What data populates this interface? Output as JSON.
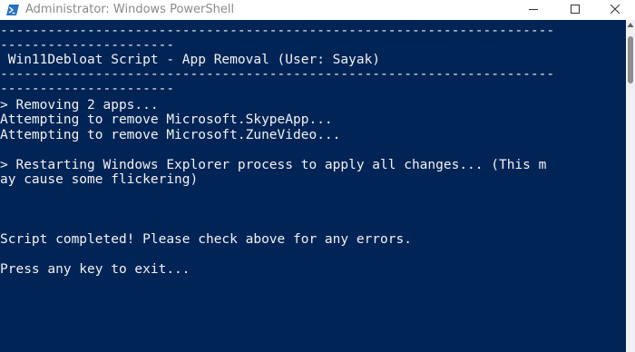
{
  "window": {
    "title": "Administrator: Windows PowerShell",
    "icon": "powershell-icon",
    "controls": [
      "minimize-icon",
      "maximize-icon",
      "close-icon"
    ],
    "colors": {
      "console_background": "#012456",
      "console_text": "#f2f2f2",
      "titlebar": "#ffffff"
    }
  },
  "console": {
    "lines": [
      "----------------------------------------------------------------------",
      "----------------------",
      " Win11Debloat Script - App Removal (User: Sayak)",
      "----------------------------------------------------------------------",
      "----------------------",
      "> Removing 2 apps...",
      "Attempting to remove Microsoft.SkypeApp...",
      "Attempting to remove Microsoft.ZuneVideo...",
      "",
      "> Restarting Windows Explorer process to apply all changes... (This m",
      "ay cause some flickering)",
      "",
      "",
      "",
      "Script completed! Please check above for any errors.",
      "",
      "Press any key to exit..."
    ]
  }
}
